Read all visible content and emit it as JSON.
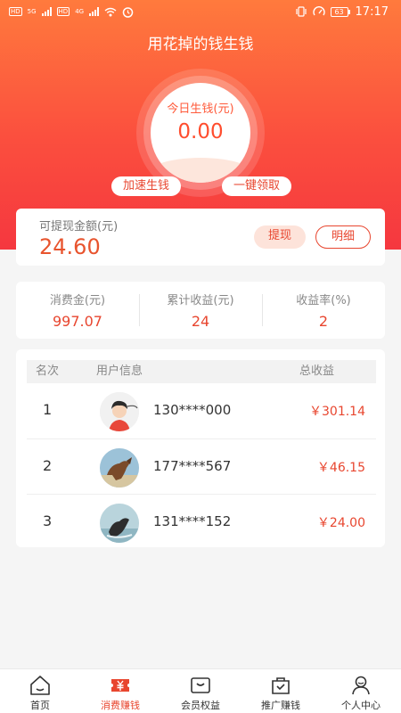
{
  "status_bar": {
    "time": "17:17",
    "battery": "63",
    "tag_hd": "HD",
    "net_5g": "5G",
    "net_4g": "4G"
  },
  "header": {
    "title": "用花掉的钱生钱"
  },
  "today_earnings": {
    "label": "今日生钱(元)",
    "value": "0.00"
  },
  "actions": {
    "speed_up": "加速生钱",
    "one_click_claim": "一键领取"
  },
  "withdraw": {
    "label": "可提现金额(元)",
    "amount": "24.60",
    "withdraw_button": "提现",
    "details_button": "明细"
  },
  "stats": [
    {
      "label": "消费金(元)",
      "value": "997.07"
    },
    {
      "label": "累计收益(元)",
      "value": "24"
    },
    {
      "label": "收益率(%)",
      "value": "2"
    }
  ],
  "ranking": {
    "headers": {
      "rank": "名次",
      "user": "用户信息",
      "total": "总收益"
    },
    "rows": [
      {
        "rank": "1",
        "phone": "130****000",
        "earnings": "￥301.14"
      },
      {
        "rank": "2",
        "phone": "177****567",
        "earnings": "￥46.15"
      },
      {
        "rank": "3",
        "phone": "131****152",
        "earnings": "￥24.00"
      }
    ]
  },
  "tabbar": {
    "items": [
      {
        "label": "首页",
        "icon": "home-icon"
      },
      {
        "label": "消费赚钱",
        "icon": "coupon-yen-icon"
      },
      {
        "label": "会员权益",
        "icon": "member-card-icon"
      },
      {
        "label": "推广赚钱",
        "icon": "share-bag-icon"
      },
      {
        "label": "个人中心",
        "icon": "person-icon"
      }
    ],
    "active_index": 1
  },
  "colors": {
    "accent": "#e8462f",
    "hero_top": "#ff7a3d",
    "hero_bottom": "#f5373f",
    "background": "#f5f5f5"
  }
}
